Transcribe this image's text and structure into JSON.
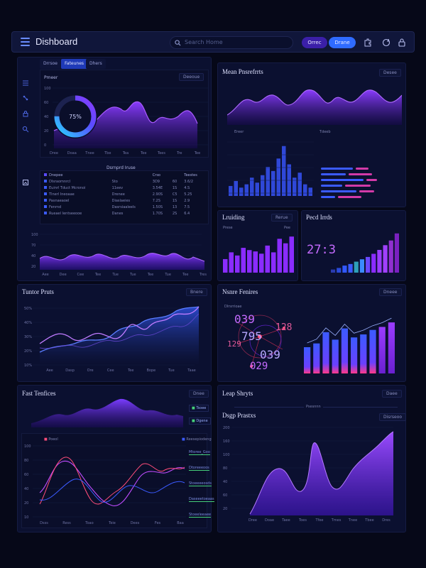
{
  "header": {
    "title": "Dishboard",
    "search_placeholder": "Search Home",
    "btn_primary": "Orrec",
    "btn_secondary": "Drane"
  },
  "left_panel": {
    "tabs": [
      "Drrsoe",
      "Fateunes",
      "Dhers"
    ],
    "card_label": "Pmeer",
    "card_dropdown": "Deeoue",
    "donut_value": "75%",
    "donut_fraction": 0.75,
    "x_ticks": [
      "Dree",
      "Doaa",
      "Tnee",
      "Tbe",
      "Tea",
      "Tee",
      "Tees",
      "Tre",
      "Tee"
    ],
    "y_ticks": [
      "100",
      "60",
      "40",
      "20",
      "0"
    ],
    "table_title": "Dsrnprd Iruse",
    "table_header": [
      "Dnepee",
      "Crso",
      "Teestes"
    ],
    "table_rows": [
      [
        "Dlsraomnrcl",
        "Sto",
        "60"
      ],
      [
        "Euinrl Tduct Mcronoi",
        "11eev",
        "1S"
      ],
      [
        "Tlnerl Ineoaae",
        "Drenee",
        "C5"
      ],
      [
        "Pasnaeaoel",
        "Diaslaeies",
        "1S"
      ],
      [
        "Fenrnd",
        "Dasrsiaaleels",
        "13"
      ],
      [
        "Rueael Ientseeooe",
        "Danes",
        "2S"
      ]
    ],
    "table_values": [
      [
        "3D9",
        "3.6/2"
      ],
      [
        "3.54E",
        "4.S"
      ],
      [
        "2.90S",
        "5.25"
      ],
      [
        "7.2S",
        "2.9"
      ],
      [
        "1.50S",
        "7.5"
      ],
      [
        "1.70S",
        "6.4"
      ]
    ],
    "wave_y_ticks": [
      "100",
      "70",
      "40",
      "20"
    ],
    "wave_x_ticks": [
      "Aee",
      "Dee",
      "Cee",
      "Tee",
      "Tue",
      "Tue",
      "Tee",
      "Tue",
      "Tee",
      "Tres"
    ]
  },
  "mean_metrics": {
    "title": "Mean Pnsrefrrts",
    "dropdown": "Desee",
    "label_left": "Ereer",
    "label_right": "Tdeeb",
    "bar_values": [
      12,
      18,
      10,
      14,
      22,
      16,
      25,
      35,
      30,
      45,
      60,
      38,
      22,
      28,
      14,
      10
    ],
    "hbar_rows": [
      {
        "a": 0.45,
        "b": 0.3
      },
      {
        "a": 0.35,
        "b": 0.55
      },
      {
        "a": 0.6,
        "b": 0.25
      },
      {
        "a": 0.3,
        "b": 0.6
      },
      {
        "a": 0.5,
        "b": 0.35
      },
      {
        "a": 0.2,
        "b": 0.55
      }
    ]
  },
  "loading": {
    "title": "Lruiding",
    "dropdown": "Rerue",
    "label_a": "Prese",
    "label_b": "Pee",
    "bar_values": [
      30,
      45,
      38,
      55,
      50,
      47,
      42,
      60,
      45,
      75,
      65,
      80
    ]
  },
  "panel_tiles": {
    "title": "Pecd Irrds",
    "value": "27:3",
    "bar_values": [
      8,
      12,
      18,
      22,
      28,
      34,
      40,
      48,
      58,
      70,
      82,
      100
    ]
  },
  "tuning": {
    "title": "Tuntor Pruts",
    "dropdown": "Bnere",
    "y_ticks": [
      "50%",
      "40%",
      "30%",
      "20%",
      "10%"
    ],
    "x_ticks": [
      "Aee",
      "Dasp",
      "Ore",
      "Cee",
      "Tee",
      "Bope",
      "Tue",
      "Taae"
    ]
  },
  "new_features": {
    "title": "Nsnre Fenires",
    "dropdown": "Dneee",
    "sublabel": "Dlrsrrioae",
    "num_a": "039",
    "num_b": "795",
    "num_c": "039",
    "num_d": "029",
    "num_e": "129",
    "num_f": "128",
    "bar_values": [
      35,
      40,
      55,
      45,
      60,
      48,
      52,
      58,
      62,
      68
    ]
  },
  "fast_functions": {
    "title": "Fast Tenfices",
    "dropdown": "Dnee",
    "legend_a": "Tsoee",
    "legend_b": "Dgene",
    "chart_legend_a": "Poeol",
    "chart_legend_b": "Reesepiodeng",
    "y_ticks": [
      "100",
      "80",
      "60",
      "40",
      "20",
      "10"
    ],
    "x_ticks": [
      "Dsss",
      "Ress",
      "Toao",
      "Teie",
      "Dees",
      "Fes",
      "Baa"
    ],
    "side_labels": [
      "Mtoree_Goo",
      "Dtoreeeoos",
      "Stoeeeeosds",
      "Daseeetoeaas",
      "Stoeeleeaee"
    ]
  },
  "loop_shifts": {
    "title": "Leap Shryts",
    "dropdown": "Daee",
    "sublabel": "Psesnnn",
    "inner_title": "Dsgp Prastxs",
    "inner_dropdown": "Disrseoo",
    "y_ticks": [
      "200",
      "160",
      "100",
      "80",
      "40",
      "60",
      "20"
    ],
    "x_ticks": [
      "Dree",
      "Doae",
      "Taee",
      "Toes",
      "Tfee",
      "Tmes",
      "Tnee",
      "Tbee",
      "Dres"
    ]
  }
}
